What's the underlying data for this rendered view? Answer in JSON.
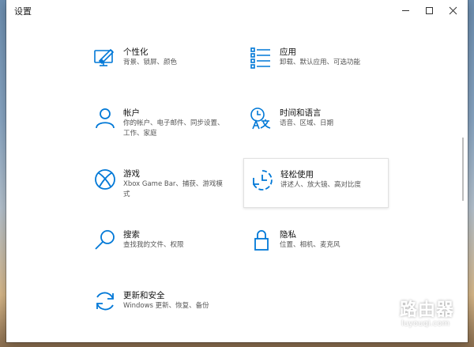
{
  "window": {
    "title": "设置"
  },
  "accent_color": "#0078d7",
  "items": {
    "personalization": {
      "name": "个性化",
      "desc": "背景、锁屏、颜色",
      "icon": "personalization-icon"
    },
    "apps": {
      "name": "应用",
      "desc": "卸载、默认应用、可选功能",
      "icon": "apps-list-icon"
    },
    "accounts": {
      "name": "帐户",
      "desc": "你的帐户、电子邮件、同步设置、工作、家庭",
      "icon": "person-icon"
    },
    "time_language": {
      "name": "时间和语言",
      "desc": "语音、区域、日期",
      "icon": "time-language-icon"
    },
    "gaming": {
      "name": "游戏",
      "desc": "Xbox Game Bar、捕获、游戏模式",
      "icon": "xbox-icon"
    },
    "ease_of_access": {
      "name": "轻松使用",
      "desc": "讲述人、放大镜、高对比度",
      "icon": "ease-of-access-icon"
    },
    "search": {
      "name": "搜索",
      "desc": "查找我的文件、权限",
      "icon": "search-icon"
    },
    "privacy": {
      "name": "隐私",
      "desc": "位置、相机、麦克风",
      "icon": "lock-icon"
    },
    "update_security": {
      "name": "更新和安全",
      "desc": "Windows 更新、恢复、备份",
      "icon": "sync-icon"
    }
  },
  "watermark": {
    "title": "路由器",
    "url": "luyouqi.com"
  }
}
